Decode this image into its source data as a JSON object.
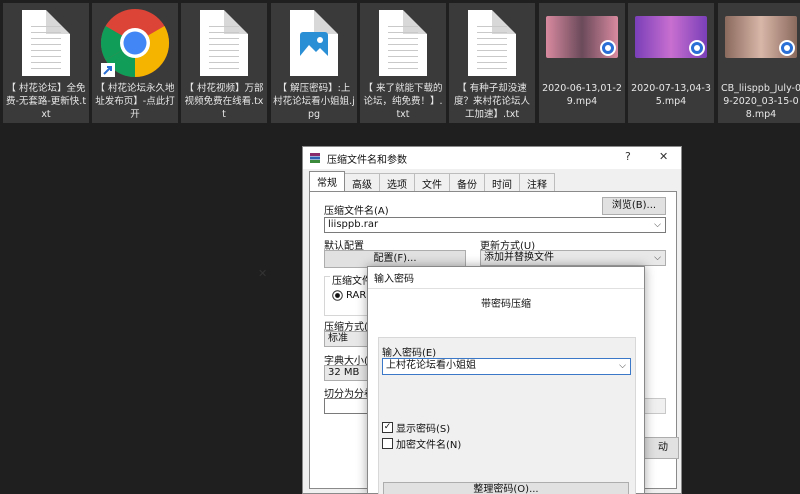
{
  "desktop": {
    "files": [
      {
        "kind": "txt",
        "name": "【 村花论坛】全免费-无套路-更新快.txt"
      },
      {
        "kind": "chrome",
        "name": "【 村花论坛永久地址发布页】-点此打开"
      },
      {
        "kind": "txt",
        "name": "【 村花视频】万部视频免费在线看.txt"
      },
      {
        "kind": "jpg",
        "name": "【 解压密码】:上村花论坛看小姐姐.jpg"
      },
      {
        "kind": "txt",
        "name": "【 来了就能下载的论坛，纯免费！】.txt"
      },
      {
        "kind": "txt",
        "name": "【 有种子却没速度？来村花论坛人工加速】.txt"
      },
      {
        "kind": "mp4",
        "name": "2020-06-13,01-29.mp4",
        "colors": [
          "#d98aa0",
          "#6a4a5a"
        ]
      },
      {
        "kind": "mp4",
        "name": "2020-07-13,04-35.mp4",
        "colors": [
          "#7a3fb8",
          "#c86fd0"
        ]
      },
      {
        "kind": "mp4",
        "name": "CB_liisppb_July-09-2020_03-15-08.mp4",
        "colors": [
          "#8b6a5e",
          "#d8b6a8"
        ]
      }
    ]
  },
  "archive_dialog": {
    "title": "压缩文件名和参数",
    "help": "?",
    "close": "✕",
    "tabs": [
      "常规",
      "高级",
      "选项",
      "文件",
      "备份",
      "时间",
      "注释"
    ],
    "archive_name_label": "压缩文件名(A)",
    "browse_button": "浏览(B)...",
    "archive_name_value": "liisppb.rar",
    "default_profile_label": "默认配置",
    "profile_button": "配置(F)...",
    "update_mode_label": "更新方式(U)",
    "update_mode_value": "添加并替换文件",
    "format_label": "压缩文件",
    "format_rar": "RAR",
    "method_label": "压缩方式(",
    "method_value": "标准",
    "dict_label": "字典大小(",
    "dict_value": "32 MB",
    "split_label": "切分为分卷",
    "ok_partial": "动"
  },
  "password_dialog": {
    "title": "输入密码",
    "close": "✕",
    "heading": "带密码压缩",
    "password_label": "输入密码(E)",
    "password_value": "上村花论坛看小姐姐",
    "show_password": "显示密码(S)",
    "encrypt_names": "加密文件名(N)",
    "organize_button": "整理密码(O)..."
  }
}
